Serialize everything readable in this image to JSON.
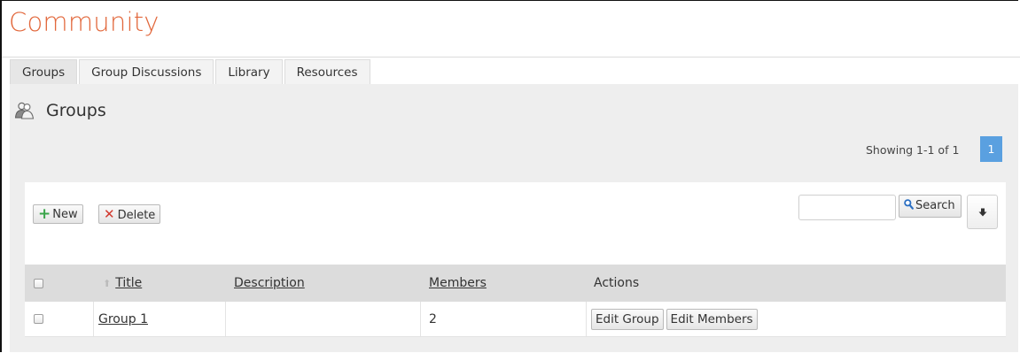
{
  "page": {
    "title": "Community"
  },
  "tabs": [
    {
      "label": "Groups",
      "active": true
    },
    {
      "label": "Group Discussions",
      "active": false
    },
    {
      "label": "Library",
      "active": false
    },
    {
      "label": "Resources",
      "active": false
    }
  ],
  "section": {
    "title": "Groups",
    "icon": "users-icon"
  },
  "pagination": {
    "showing": "Showing 1-1 of 1",
    "current_page": "1"
  },
  "toolbar": {
    "new_label": "New",
    "delete_label": "Delete",
    "search_label": "Search",
    "search_value": "",
    "export_icon": "download-arrow-icon"
  },
  "table": {
    "headers": {
      "title": "Title",
      "description": "Description",
      "members": "Members",
      "actions": "Actions"
    },
    "rows": [
      {
        "title": "Group 1",
        "description": "",
        "members": "2",
        "actions": [
          "Edit Group",
          "Edit Members"
        ]
      }
    ]
  },
  "colors": {
    "title": "#e2683c",
    "page_badge": "#5aa0e0",
    "new_icon": "#3aa44a",
    "delete_icon": "#d23a2f"
  }
}
